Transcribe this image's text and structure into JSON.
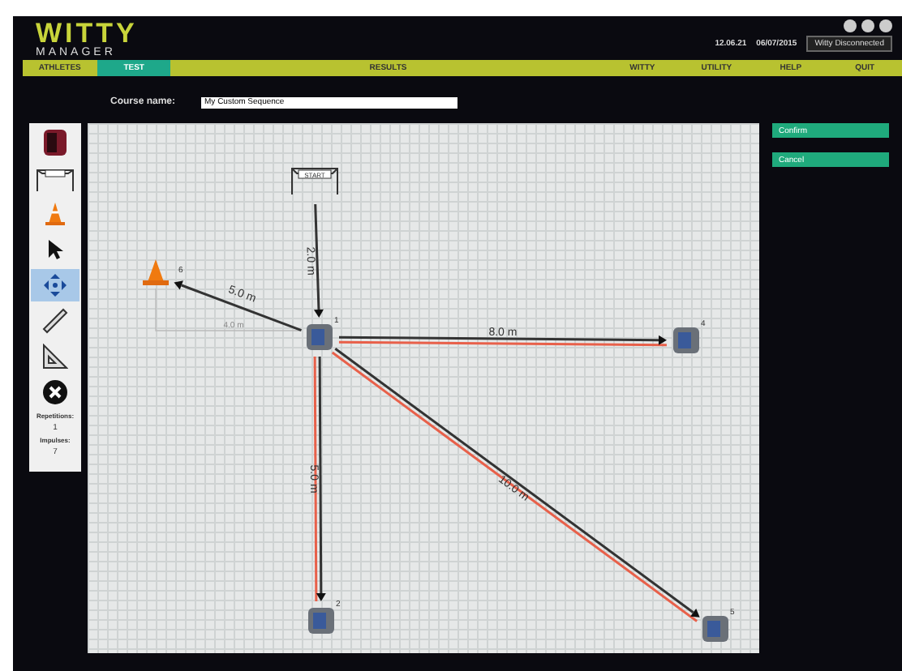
{
  "header": {
    "logo_top": "WITTY",
    "logo_bottom": "MANAGER",
    "time": "12.06.21",
    "date": "06/07/2015",
    "status": "Witty Disconnected"
  },
  "nav": [
    {
      "label": "ATHLETES",
      "selected": false
    },
    {
      "label": "TEST",
      "selected": true
    },
    {
      "label": "RESULTS",
      "selected": false
    },
    {
      "label": "WITTY",
      "selected": false
    },
    {
      "label": "UTILITY",
      "selected": false
    },
    {
      "label": "HELP",
      "selected": false
    },
    {
      "label": "QUIT",
      "selected": false
    }
  ],
  "course": {
    "label": "Course name:",
    "value": "My Custom Sequence"
  },
  "tools": [
    {
      "kind": "witty",
      "selected": false
    },
    {
      "kind": "gate",
      "selected": false
    },
    {
      "kind": "cone",
      "selected": false
    },
    {
      "kind": "pointer",
      "selected": false
    },
    {
      "kind": "move",
      "selected": true
    },
    {
      "kind": "ruler",
      "selected": false
    },
    {
      "kind": "square",
      "selected": false
    },
    {
      "kind": "delete",
      "selected": false
    }
  ],
  "repetitions": {
    "label": "Repetitions:",
    "value": "1"
  },
  "impulses": {
    "label": "Impulses:",
    "value": "7"
  },
  "canvas": {
    "nodes": [
      {
        "kind": "gate",
        "label": "START"
      },
      {
        "kind": "witty",
        "label": "1"
      },
      {
        "kind": "cone",
        "label": "6"
      },
      {
        "kind": "witty",
        "label": "4"
      },
      {
        "kind": "witty",
        "label": "2"
      },
      {
        "kind": "witty",
        "label": "5"
      }
    ],
    "edges": [
      {
        "label": "2.0 m",
        "return": false
      },
      {
        "label": "5.0 m",
        "return": false
      },
      {
        "label": "8.0 m",
        "return": true
      },
      {
        "label": "5.0 m",
        "return": true
      },
      {
        "label": "10.0 m",
        "return": true
      }
    ],
    "guide": "4.0 m"
  },
  "buttons": [
    "Confirm",
    "Cancel"
  ]
}
